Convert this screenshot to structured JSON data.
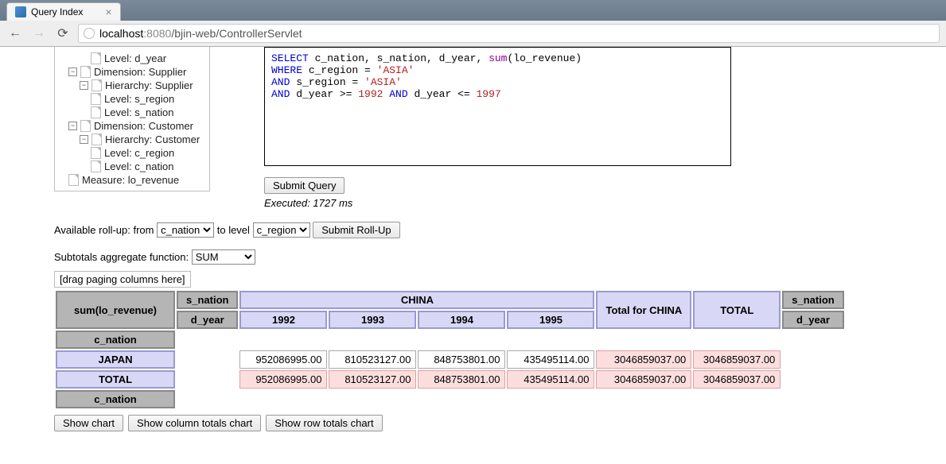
{
  "browser": {
    "tab_title": "Query Index",
    "url_host": "localhost",
    "url_port": ":8080",
    "url_path": "/bjin-web/ControllerServlet"
  },
  "tree": {
    "n0": "Level: d_year",
    "n1": "Dimension: Supplier",
    "n2": "Hierarchy: Supplier",
    "n3": "Level: s_region",
    "n4": "Level: s_nation",
    "n5": "Dimension: Customer",
    "n6": "Hierarchy: Customer",
    "n7": "Level: c_region",
    "n8": "Level: c_nation",
    "n9": "Measure: lo_revenue"
  },
  "sql": {
    "select": "SELECT",
    "select_cols": " c_nation, s_nation, d_year, ",
    "sum": "sum",
    "sum_arg": "(lo_revenue)",
    "where": "WHERE",
    "where_body": " c_region = ",
    "asia1": "'ASIA'",
    "and1": "AND",
    "and1_body": " s_region = ",
    "asia2": "'ASIA'",
    "and2": "AND",
    "and2_body": " d_year >= ",
    "y1": "1992",
    "and3": " AND ",
    "and3_body": "d_year <= ",
    "y2": "1997"
  },
  "buttons": {
    "submit_query": "Submit Query",
    "submit_rollup": "Submit Roll-Up",
    "show_chart": "Show chart",
    "show_col_chart": "Show column totals chart",
    "show_row_chart": "Show row totals chart"
  },
  "status": "Executed: 1727 ms",
  "rollup": {
    "label_from": "Available roll-up: from",
    "from_value": "c_nation",
    "label_to": "to level",
    "to_value": "c_region"
  },
  "subtotals": {
    "label": "Subtotals aggregate function:",
    "value": "SUM"
  },
  "drag_hint": "[drag paging columns here]",
  "pivot": {
    "measure": "sum(lo_revenue)",
    "s_nation": "s_nation",
    "d_year": "d_year",
    "c_nation": "c_nation",
    "col_group": "CHINA",
    "years": {
      "y0": "1992",
      "y1": "1993",
      "y2": "1994",
      "y3": "1995"
    },
    "total_for_china": "Total for CHINA",
    "total": "TOTAL",
    "row_label": "JAPAN",
    "row_total_label": "TOTAL",
    "r0": {
      "c0": "952086995.00",
      "c1": "810523127.00",
      "c2": "848753801.00",
      "c3": "435495114.00",
      "tc": "3046859037.00",
      "gt": "3046859037.00"
    },
    "r1": {
      "c0": "952086995.00",
      "c1": "810523127.00",
      "c2": "848753801.00",
      "c3": "435495114.00",
      "tc": "3046859037.00",
      "gt": "3046859037.00"
    }
  }
}
